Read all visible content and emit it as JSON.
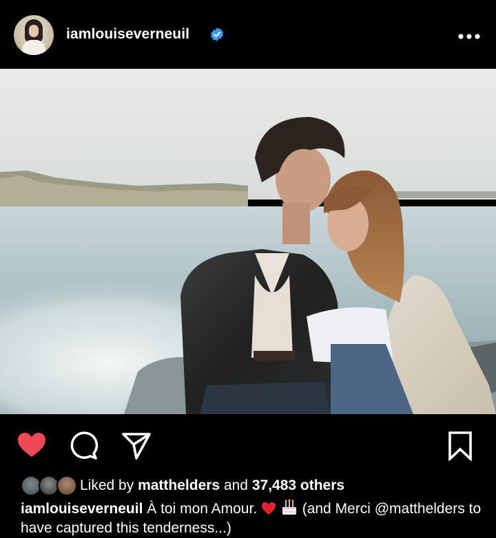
{
  "post": {
    "username": "iamlouiseverneuil",
    "verified": true,
    "more_icon": "more-horizontal-icon",
    "more_label": "•••"
  },
  "photo": {
    "alt": "Couple embracing on a boat with shoreline behind them"
  },
  "actions": {
    "like_icon": "heart-filled-icon",
    "like_color": "#ed4956",
    "comment_icon": "comment-icon",
    "share_icon": "send-icon",
    "save_icon": "bookmark-icon"
  },
  "likes": {
    "prefix": "Liked by",
    "first_liker": "matthelders",
    "connector": "and",
    "others": "37,483 others"
  },
  "caption": {
    "username": "iamlouiseverneuil",
    "text_before": "À toi mon Amour.",
    "text_after": "(and Merci @matthelders to have captured this tenderness...)",
    "emojis": [
      "red-heart-emoji",
      "birthday-cake-emoji"
    ]
  },
  "colors": {
    "background": "#000000",
    "verified_badge": "#3897f0",
    "text": "#ffffff"
  }
}
